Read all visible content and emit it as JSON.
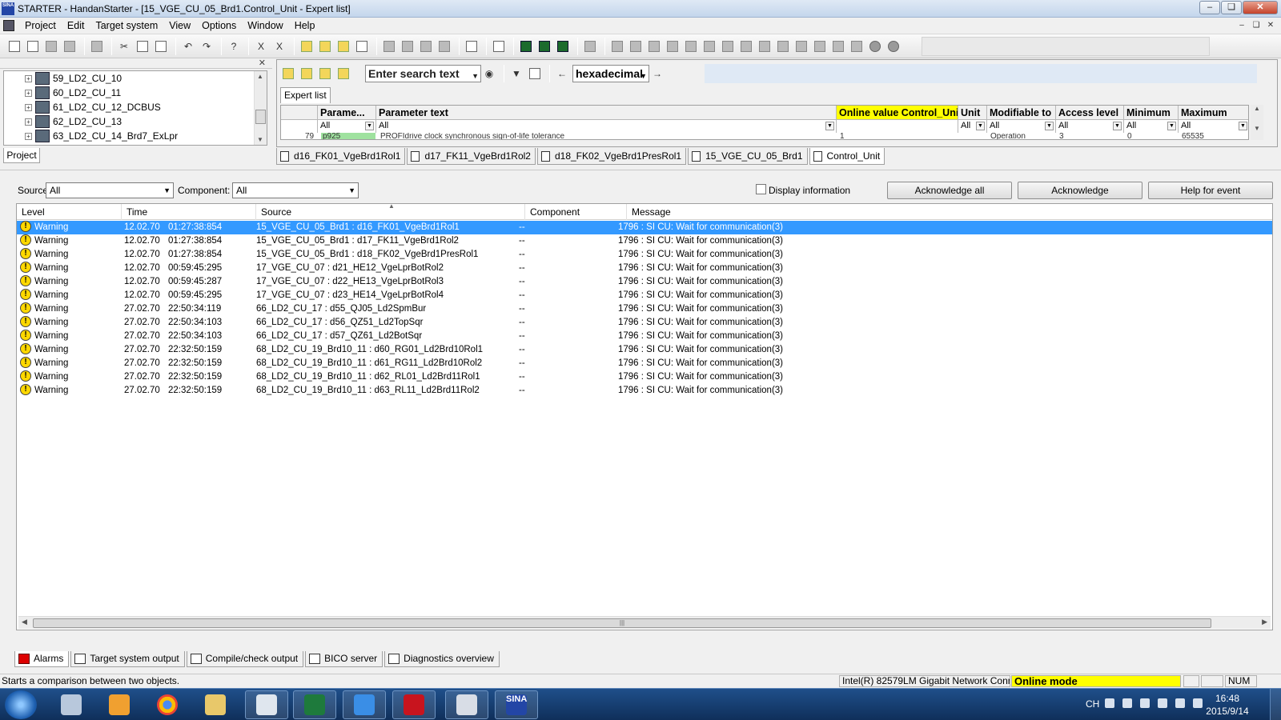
{
  "window": {
    "title": "STARTER - HandanStarter - [15_VGE_CU_05_Brd1.Control_Unit - Expert list]",
    "app_icon_text": "SINA"
  },
  "menu": [
    "Project",
    "Edit",
    "Target system",
    "View",
    "Options",
    "Window",
    "Help"
  ],
  "project_tree": {
    "items": [
      "59_LD2_CU_10",
      "60_LD2_CU_11",
      "61_LD2_CU_12_DCBUS",
      "62_LD2_CU_13",
      "63_LD2_CU_14_Brd7_ExLpr"
    ],
    "tab_label": "Project"
  },
  "expert": {
    "search_text": "Enter search text",
    "number_format": "hexadecimal",
    "tab_label": "Expert list",
    "columns": [
      "Parame...",
      "Parameter text",
      "Online value Control_Unit",
      "Unit",
      "Modifiable to",
      "Access level",
      "Minimum",
      "Maximum"
    ],
    "filters": [
      "All",
      "All",
      "",
      "All",
      "All",
      "All",
      "All",
      "All"
    ],
    "partial_row": {
      "index": "79",
      "param": "p925",
      "text": "PROFIdrive clock synchronous sign-of-life tolerance",
      "value": "1",
      "modifiable": "Operation",
      "access": "3",
      "minimum": "0",
      "maximum": "65535"
    }
  },
  "doc_tabs": [
    "d16_FK01_VgeBrd1Rol1",
    "d17_FK11_VgeBrd1Rol2",
    "d18_FK02_VgeBrd1PresRol1",
    "15_VGE_CU_05_Brd1",
    "Control_Unit"
  ],
  "alarms": {
    "source_label": "Source",
    "source_value": "All",
    "component_label": "Component:",
    "component_value": "All",
    "display_info_label": "Display information",
    "btn_ack_all": "Acknowledge all",
    "btn_ack": "Acknowledge",
    "btn_help": "Help for event",
    "columns": [
      "Level",
      "Time",
      "Source",
      "Component",
      "Message"
    ],
    "rows": [
      {
        "level": "Warning",
        "date": "12.02.70",
        "time": "01:27:38:854",
        "source": "15_VGE_CU_05_Brd1 : d16_FK01_VgeBrd1Rol1",
        "component": "--",
        "message": "1796 : SI CU: Wait for communication(3)"
      },
      {
        "level": "Warning",
        "date": "12.02.70",
        "time": "01:27:38:854",
        "source": "15_VGE_CU_05_Brd1 : d17_FK11_VgeBrd1Rol2",
        "component": "--",
        "message": "1796 : SI CU: Wait for communication(3)"
      },
      {
        "level": "Warning",
        "date": "12.02.70",
        "time": "01:27:38:854",
        "source": "15_VGE_CU_05_Brd1 : d18_FK02_VgeBrd1PresRol1",
        "component": "--",
        "message": "1796 : SI CU: Wait for communication(3)"
      },
      {
        "level": "Warning",
        "date": "12.02.70",
        "time": "00:59:45:295",
        "source": "17_VGE_CU_07 : d21_HE12_VgeLprBotRol2",
        "component": "--",
        "message": "1796 : SI CU: Wait for communication(3)"
      },
      {
        "level": "Warning",
        "date": "12.02.70",
        "time": "00:59:45:287",
        "source": "17_VGE_CU_07 : d22_HE13_VgeLprBotRol3",
        "component": "--",
        "message": "1796 : SI CU: Wait for communication(3)"
      },
      {
        "level": "Warning",
        "date": "12.02.70",
        "time": "00:59:45:295",
        "source": "17_VGE_CU_07 : d23_HE14_VgeLprBotRol4",
        "component": "--",
        "message": "1796 : SI CU: Wait for communication(3)"
      },
      {
        "level": "Warning",
        "date": "27.02.70",
        "time": "22:50:34:119",
        "source": "66_LD2_CU_17 : d55_QJ05_Ld2SpmBur",
        "component": "--",
        "message": "1796 : SI CU: Wait for communication(3)"
      },
      {
        "level": "Warning",
        "date": "27.02.70",
        "time": "22:50:34:103",
        "source": "66_LD2_CU_17 : d56_QZ51_Ld2TopSqr",
        "component": "--",
        "message": "1796 : SI CU: Wait for communication(3)"
      },
      {
        "level": "Warning",
        "date": "27.02.70",
        "time": "22:50:34:103",
        "source": "66_LD2_CU_17 : d57_QZ61_Ld2BotSqr",
        "component": "--",
        "message": "1796 : SI CU: Wait for communication(3)"
      },
      {
        "level": "Warning",
        "date": "27.02.70",
        "time": "22:32:50:159",
        "source": "68_LD2_CU_19_Brd10_11 : d60_RG01_Ld2Brd10Rol1",
        "component": "--",
        "message": "1796 : SI CU: Wait for communication(3)"
      },
      {
        "level": "Warning",
        "date": "27.02.70",
        "time": "22:32:50:159",
        "source": "68_LD2_CU_19_Brd10_11 : d61_RG11_Ld2Brd10Rol2",
        "component": "--",
        "message": "1796 : SI CU: Wait for communication(3)"
      },
      {
        "level": "Warning",
        "date": "27.02.70",
        "time": "22:32:50:159",
        "source": "68_LD2_CU_19_Brd10_11 : d62_RL01_Ld2Brd11Rol1",
        "component": "--",
        "message": "1796 : SI CU: Wait for communication(3)"
      },
      {
        "level": "Warning",
        "date": "27.02.70",
        "time": "22:32:50:159",
        "source": "68_LD2_CU_19_Brd10_11 : d63_RL11_Ld2Brd11Rol2",
        "component": "--",
        "message": "1796 : SI CU: Wait for communication(3)"
      }
    ]
  },
  "bottom_tabs": [
    "Alarms",
    "Target system output",
    "Compile/check output",
    "BICO server",
    "Diagnostics overview"
  ],
  "status": {
    "message": "Starts a comparison between two objects.",
    "network": "Intel(R) 82579LM Gigabit Network Conn",
    "mode": "Online mode",
    "num": "NUM"
  },
  "taskbar": {
    "lang": "CH",
    "time": "16:48",
    "date": "2015/9/14",
    "sinamics_icon_text": "SINA"
  },
  "colors": {
    "selection": "#3399ff",
    "online_yellow": "#ffff00",
    "taskbar": "#1f4f8a"
  }
}
